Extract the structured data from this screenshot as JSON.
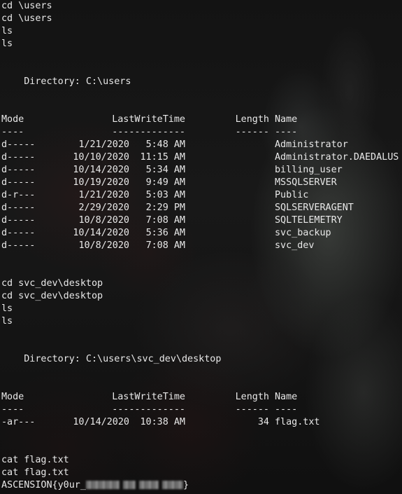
{
  "commands": {
    "cd_users": "cd \\users",
    "ls": "ls",
    "cd_desktop": "cd svc_dev\\desktop",
    "cat_flag": "cat flag.txt"
  },
  "listing1": {
    "directory": "    Directory: C:\\users",
    "headers": {
      "mode": "Mode",
      "lastwritetime": "LastWriteTime",
      "length": "Length",
      "name": "Name"
    },
    "underlines": {
      "mode": "----",
      "lastwritetime": "-------------",
      "length": "------",
      "name": "----"
    },
    "rows": [
      {
        "mode": "d-----",
        "date": "1/21/2020",
        "time": "5:48 AM",
        "length": "",
        "name": "Administrator"
      },
      {
        "mode": "d-----",
        "date": "10/10/2020",
        "time": "11:15 AM",
        "length": "",
        "name": "Administrator.DAEDALUS"
      },
      {
        "mode": "d-----",
        "date": "10/14/2020",
        "time": "5:34 AM",
        "length": "",
        "name": "billing_user"
      },
      {
        "mode": "d-----",
        "date": "10/19/2020",
        "time": "9:49 AM",
        "length": "",
        "name": "MSSQLSERVER"
      },
      {
        "mode": "d-r---",
        "date": "1/21/2020",
        "time": "5:03 AM",
        "length": "",
        "name": "Public"
      },
      {
        "mode": "d-----",
        "date": "2/29/2020",
        "time": "2:29 PM",
        "length": "",
        "name": "SQLSERVERAGENT"
      },
      {
        "mode": "d-----",
        "date": "10/8/2020",
        "time": "7:08 AM",
        "length": "",
        "name": "SQLTELEMETRY"
      },
      {
        "mode": "d-----",
        "date": "10/14/2020",
        "time": "5:36 AM",
        "length": "",
        "name": "svc_backup"
      },
      {
        "mode": "d-----",
        "date": "10/8/2020",
        "time": "7:08 AM",
        "length": "",
        "name": "svc_dev"
      }
    ]
  },
  "listing2": {
    "directory": "    Directory: C:\\users\\svc_dev\\desktop",
    "headers": {
      "mode": "Mode",
      "lastwritetime": "LastWriteTime",
      "length": "Length",
      "name": "Name"
    },
    "underlines": {
      "mode": "----",
      "lastwritetime": "-------------",
      "length": "------",
      "name": "----"
    },
    "rows": [
      {
        "mode": "-ar---",
        "date": "10/14/2020",
        "time": "10:38 AM",
        "length": "34",
        "name": "flag.txt"
      }
    ]
  },
  "flag": {
    "prefix": "ASCENSION{y0ur_",
    "suffix": "}"
  },
  "theme": {
    "background": "#141414",
    "text": "#e8e8e8"
  }
}
